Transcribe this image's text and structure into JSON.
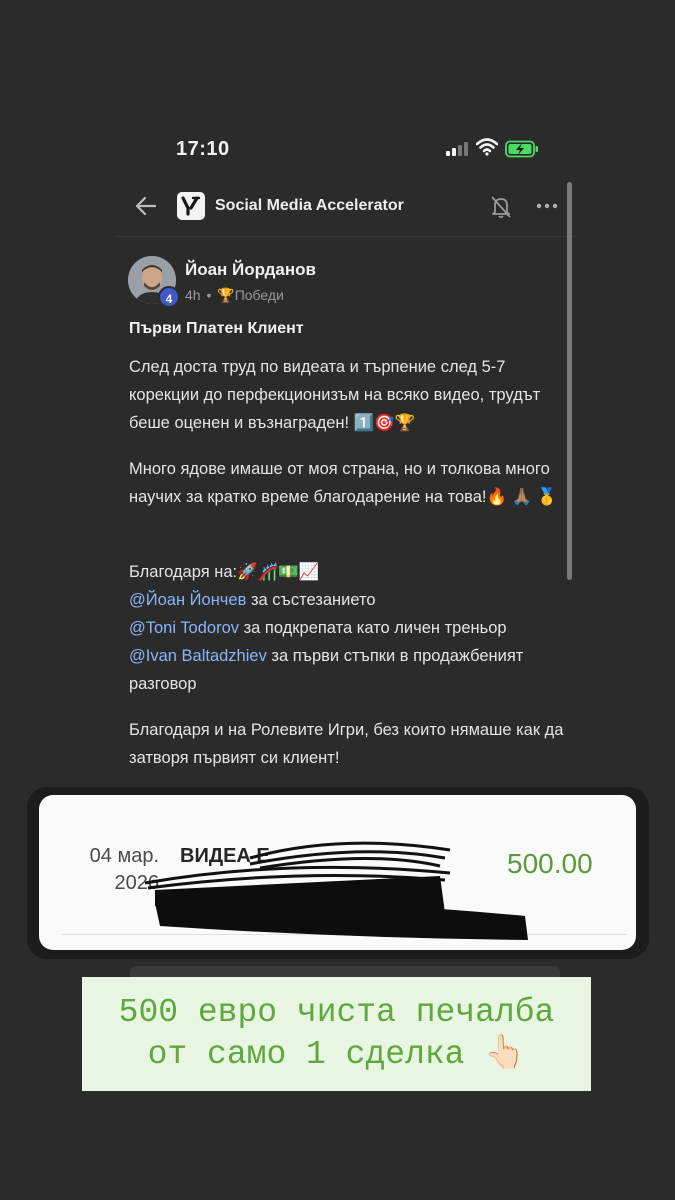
{
  "status_bar": {
    "time": "17:10"
  },
  "header": {
    "group_name": "Social Media Accelerator"
  },
  "post": {
    "author": "Йоан Йорданов",
    "level": "4",
    "time_ago": "4h",
    "separator": "•",
    "category": "🏆Победи",
    "title": "Първи Платен Клиент",
    "p1": "След доста труд по видеата и търпение след 5-7 корекции до перфекционизъм на всяко видео, трудът беше оценен и възнаграден! 1️⃣🎯🏆",
    "p2": "Много ядове имаше от моя страна, но и толкова много научих за кратко време благодарение на това!🔥 🙏🏽 🥇",
    "thanks_intro": "Благодаря на:🚀🎢💵📈",
    "thanks": [
      {
        "mention": "@Йоан Йончев",
        "text": " за състезанието"
      },
      {
        "mention": "@Toni Todorov",
        "text": " за подкрепата като личен треньор"
      },
      {
        "mention": "@Ivan Baltadzhiev",
        "text": " за първи стъпки в продажбеният разговор"
      }
    ],
    "p4": "Благодаря и на Ролевите Игри, без които нямаше как да затворя първият си клиент!"
  },
  "receipt": {
    "date_line1": "04 мар.",
    "date_line2": "2026",
    "description": "ВИДЕА Е",
    "amount": "500.00",
    "amount_color": "#5a9a3a"
  },
  "caption": {
    "line1": "500 евро чиста печалба",
    "line2": "от само 1 сделка 👆🏻",
    "background": "#e8f5e3",
    "color": "#5ea83c"
  }
}
